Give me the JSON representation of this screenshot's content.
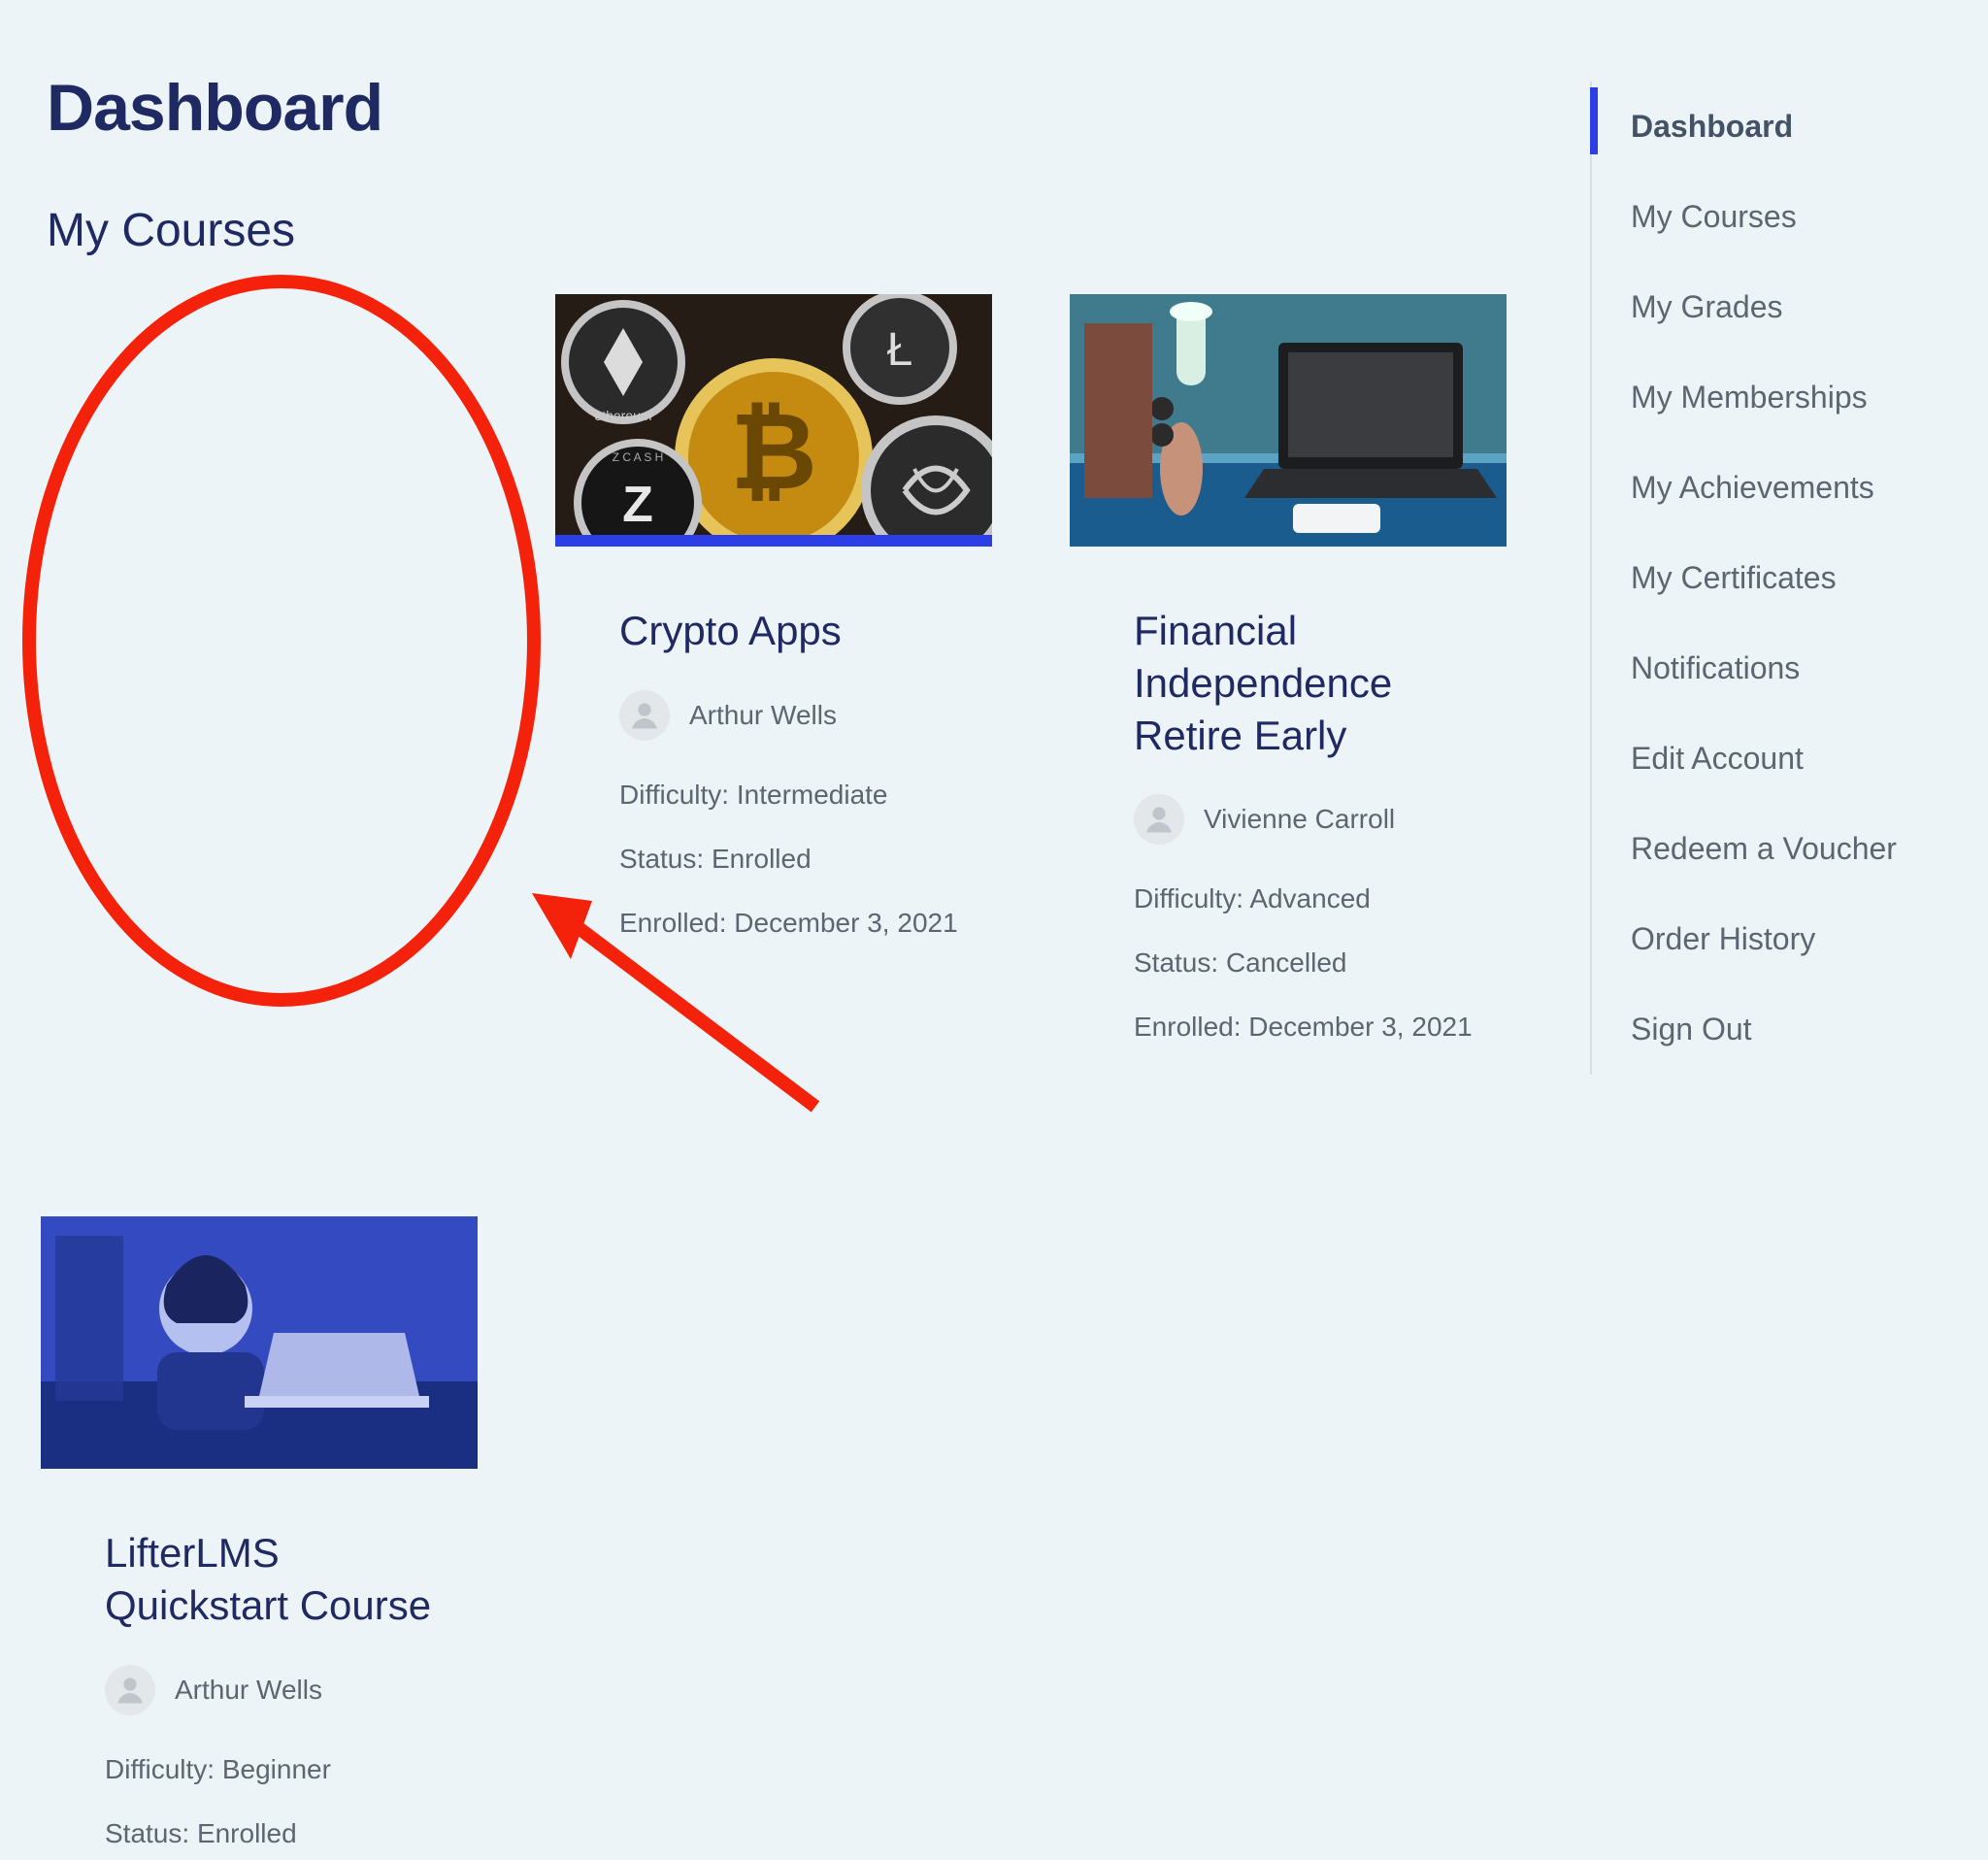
{
  "header": {
    "page_title": "Dashboard",
    "section_title": "My Courses"
  },
  "sidebar": {
    "items": [
      {
        "label": "Dashboard",
        "active": true
      },
      {
        "label": "My Courses",
        "active": false
      },
      {
        "label": "My Grades",
        "active": false
      },
      {
        "label": "My Memberships",
        "active": false
      },
      {
        "label": "My Achievements",
        "active": false
      },
      {
        "label": "My Certificates",
        "active": false
      },
      {
        "label": "Notifications",
        "active": false
      },
      {
        "label": "Edit Account",
        "active": false
      },
      {
        "label": "Redeem a Voucher",
        "active": false
      },
      {
        "label": "Order History",
        "active": false
      },
      {
        "label": "Sign Out",
        "active": false
      }
    ]
  },
  "labels": {
    "difficulty_prefix": "Difficulty: ",
    "status_prefix": "Status: ",
    "enrolled_prefix": "Enrolled: "
  },
  "courses": [
    {
      "title": "Crypto Apps",
      "author": "Arthur Wells",
      "difficulty": "Intermediate",
      "status": "Enrolled",
      "enrolled_date": "December 3, 2021",
      "progress_percent": 100,
      "thumb": "crypto"
    },
    {
      "title": "Financial Independence Retire Early",
      "author": "Vivienne Carroll",
      "difficulty": "Advanced",
      "status": "Cancelled",
      "enrolled_date": "December 3, 2021",
      "progress_percent": 0,
      "thumb": "fire"
    },
    {
      "title": "LifterLMS Quickstart Course",
      "author": "Arthur Wells",
      "difficulty": "Beginner",
      "status": "Enrolled",
      "enrolled_date": "",
      "progress_percent": 0,
      "thumb": "quickstart"
    }
  ]
}
